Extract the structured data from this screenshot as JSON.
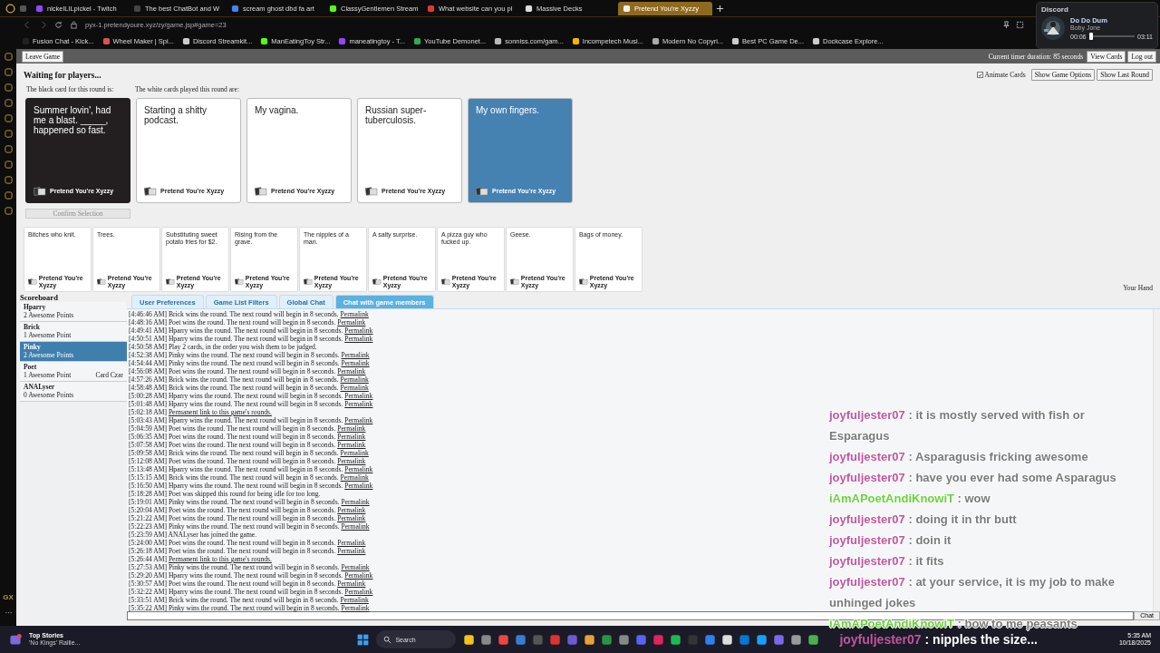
{
  "browser": {
    "tabs": [
      {
        "title": "nickelLILpickel - Twitch",
        "color": "#9146ff",
        "selected": false
      },
      {
        "title": "The best ChatBot and W",
        "color": "#444444",
        "selected": false
      },
      {
        "title": "scream ghost dbd fa art",
        "color": "#4285f4",
        "selected": false
      },
      {
        "title": "ClassyGentlemen Stream",
        "color": "#53fc18",
        "selected": false
      },
      {
        "title": "What website can you pl",
        "color": "#e03a2f",
        "selected": false
      },
      {
        "title": "Massive Decks",
        "color": "#dddddd",
        "selected": false
      },
      {
        "title": "Pretend You're Xyzzy",
        "color": "#eeeeee",
        "selected": true
      }
    ],
    "url": "pyx-1.pretendyoure.xyz/zy/game.jsp#game=23",
    "bookmarks": [
      {
        "title": "Fusion Chat - Kick...",
        "color": "#222222"
      },
      {
        "title": "Wheel Maker | Spi...",
        "color": "#d9534f"
      },
      {
        "title": "Discord Streamkit...",
        "color": "#cccccc"
      },
      {
        "title": "ManEatingToy Str...",
        "color": "#53fc18"
      },
      {
        "title": "maneatingtoy - T...",
        "color": "#9146ff"
      },
      {
        "title": "YouTube Demonet...",
        "color": "#34a853"
      },
      {
        "title": "sonniss.com/gam...",
        "color": "#bbbbbb"
      },
      {
        "title": "Incompetech Musi...",
        "color": "#f4b400"
      },
      {
        "title": "Modern No Copyri...",
        "color": "#aaaaaa"
      },
      {
        "title": "Best PC Game De...",
        "color": "#cccccc"
      },
      {
        "title": "Dockcase Explore...",
        "color": "#cccccc"
      }
    ],
    "sidebar_label": "GX"
  },
  "discord_widget": {
    "title": "Discord",
    "track": "Do Do Dum",
    "artist": "Boby Jone",
    "elapsed": "00:06",
    "duration": "03:11",
    "level": 0.05
  },
  "game": {
    "leave_button": "Leave Game",
    "timer": "Current timer duration: 85 seconds",
    "view_cards_button": "View Cards",
    "logout_button": "Log out",
    "status": "Waiting for players...",
    "animate_cards": {
      "label": "Animate Cards",
      "checked": true
    },
    "option_buttons": [
      "Show Game Options",
      "Show Last Round"
    ],
    "black_card_label": "The black card for this round is:",
    "white_cards_label": "The white cards played this round are:",
    "black_card": {
      "text": "Summer lovin', had me a blast. _____, happened so fast.",
      "brand": "Pretend You're Xyzzy"
    },
    "played_cards": [
      {
        "text": "Starting a shitty podcast.",
        "brand": "Pretend You're Xyzzy",
        "selected": false
      },
      {
        "text": "My vagina.",
        "brand": "Pretend You're Xyzzy",
        "selected": false
      },
      {
        "text": "Russian super-tuberculosis.",
        "brand": "Pretend You're Xyzzy",
        "selected": false
      },
      {
        "text": "My own fingers.",
        "brand": "Pretend You're Xyzzy",
        "selected": true
      }
    ],
    "confirm_button": {
      "label": "Confirm Selection",
      "disabled": true
    },
    "hand": [
      {
        "text": "Bitches who knit.",
        "brand": "Pretend You're Xyzzy"
      },
      {
        "text": "Trees.",
        "brand": "Pretend You're Xyzzy"
      },
      {
        "text": "Substituting sweet potato fries for $2.",
        "brand": "Pretend You're Xyzzy"
      },
      {
        "text": "Rising from the grave.",
        "brand": "Pretend You're Xyzzy"
      },
      {
        "text": "The nipples of a man.",
        "brand": "Pretend You're Xyzzy"
      },
      {
        "text": "A salty surprise.",
        "brand": "Pretend You're Xyzzy"
      },
      {
        "text": "A pizza guy who fucked up.",
        "brand": "Pretend You're Xyzzy"
      },
      {
        "text": "Geese.",
        "brand": "Pretend You're Xyzzy"
      },
      {
        "text": "Bags of money.",
        "brand": "Pretend You're Xyzzy"
      }
    ],
    "hand_label": "Your Hand"
  },
  "scoreboard": {
    "title": "Scoreboard",
    "players": [
      {
        "name": "Hparry",
        "points": "2 Awesome Points",
        "selected": false
      },
      {
        "name": "Brick",
        "points": "1 Awesome Point",
        "selected": false
      },
      {
        "name": "Pinky",
        "points": "2 Awesome Points",
        "selected": true
      },
      {
        "name": "Poet",
        "points": "1 Awesome Point",
        "role": "Card Czar",
        "selected": false
      },
      {
        "name": "ANALyser",
        "points": "0 Awesome Points",
        "selected": false
      }
    ]
  },
  "chat": {
    "tabs": [
      {
        "label": "User Preferences",
        "selected": false
      },
      {
        "label": "Game List Filters",
        "selected": false
      },
      {
        "label": "Global Chat",
        "selected": false
      },
      {
        "label": "Chat with game members",
        "selected": true
      }
    ],
    "lines": [
      {
        "time": "[4:46:46 AM]",
        "text": "Brick wins the round. The next round will begin in 8 seconds.",
        "link": "Permalink"
      },
      {
        "time": "[4:48:16 AM]",
        "text": "Poet wins the round. The next round will begin in 8 seconds.",
        "link": "Permalink"
      },
      {
        "time": "[4:49:41 AM]",
        "text": "Hparry wins the round. The next round will begin in 8 seconds.",
        "link": "Permalink"
      },
      {
        "time": "[4:50:51 AM]",
        "text": "Hparry wins the round. The next round will begin in 8 seconds.",
        "link": "Permalink"
      },
      {
        "time": "[4:50:58 AM]",
        "text": "Play 2 cards, in the order you wish them to be judged."
      },
      {
        "time": "[4:52:38 AM]",
        "text": "Pinky wins the round. The next round will begin in 8 seconds.",
        "link": "Permalink"
      },
      {
        "time": "[4:54:44 AM]",
        "text": "Pinky wins the round. The next round will begin in 8 seconds.",
        "link": "Permalink"
      },
      {
        "time": "[4:56:08 AM]",
        "text": "Poet wins the round. The next round will begin in 8 seconds.",
        "link": "Permalink"
      },
      {
        "time": "[4:57:26 AM]",
        "text": "Brick wins the round. The next round will begin in 8 seconds.",
        "link": "Permalink"
      },
      {
        "time": "[4:58:48 AM]",
        "text": "Brick wins the round. The next round will begin in 8 seconds.",
        "link": "Permalink"
      },
      {
        "time": "[5:00:28 AM]",
        "text": "Hparry wins the round. The next round will begin in 8 seconds.",
        "link": "Permalink"
      },
      {
        "time": "[5:01:48 AM]",
        "text": "Hparry wins the round. The next round will begin in 8 seconds.",
        "link": "Permalink"
      },
      {
        "time": "[5:02:18 AM]",
        "link": "Permanent link to this game's rounds."
      },
      {
        "time": "[5:03:43 AM]",
        "text": "Hparry wins the round. The next round will begin in 8 seconds.",
        "link": "Permalink"
      },
      {
        "time": "[5:04:59 AM]",
        "text": "Poet wins the round. The next round will begin in 8 seconds.",
        "link": "Permalink"
      },
      {
        "time": "[5:06:35 AM]",
        "text": "Poet wins the round. The next round will begin in 8 seconds.",
        "link": "Permalink"
      },
      {
        "time": "[5:07:58 AM]",
        "text": "Poet wins the round. The next round will begin in 8 seconds.",
        "link": "Permalink"
      },
      {
        "time": "[5:09:58 AM]",
        "text": "Brick wins the round. The next round will begin in 8 seconds.",
        "link": "Permalink"
      },
      {
        "time": "[5:12:08 AM]",
        "text": "Poet wins the round. The next round will begin in 8 seconds.",
        "link": "Permalink"
      },
      {
        "time": "[5:13:48 AM]",
        "text": "Hparry wins the round. The next round will begin in 8 seconds.",
        "link": "Permalink"
      },
      {
        "time": "[5:15:15 AM]",
        "text": "Brick wins the round. The next round will begin in 8 seconds.",
        "link": "Permalink"
      },
      {
        "time": "[5:16:50 AM]",
        "text": "Hparry wins the round. The next round will begin in 8 seconds.",
        "link": "Permalink"
      },
      {
        "time": "[5:18:28 AM]",
        "text": "Poet was skipped this round for being idle for too long."
      },
      {
        "time": "[5:19:01 AM]",
        "text": "Pinky wins the round. The next round will begin in 8 seconds.",
        "link": "Permalink"
      },
      {
        "time": "[5:20:04 AM]",
        "text": "Poet wins the round. The next round will begin in 8 seconds.",
        "link": "Permalink"
      },
      {
        "time": "[5:21:22 AM]",
        "text": "Poet wins the round. The next round will begin in 8 seconds.",
        "link": "Permalink"
      },
      {
        "time": "[5:22:23 AM]",
        "text": "Pinky wins the round. The next round will begin in 8 seconds.",
        "link": "Permalink"
      },
      {
        "time": "[5:23:59 AM]",
        "text": "ANALyser has joined the game."
      },
      {
        "time": "[5:24:00 AM]",
        "text": "Poet wins the round. The next round will begin in 8 seconds.",
        "link": "Permalink"
      },
      {
        "time": "[5:26:18 AM]",
        "text": "Poet wins the round. The next round will begin in 8 seconds.",
        "link": "Permalink"
      },
      {
        "time": "[5:26:44 AM]",
        "link": "Permanent link to this game's rounds."
      },
      {
        "time": "[5:27:53 AM]",
        "text": "Pinky wins the round. The next round will begin in 8 seconds.",
        "link": "Permalink"
      },
      {
        "time": "[5:29:20 AM]",
        "text": "Hparry wins the round. The next round will begin in 8 seconds.",
        "link": "Permalink"
      },
      {
        "time": "[5:30:57 AM]",
        "text": "Poet wins the round. The next round will begin in 8 seconds.",
        "link": "Permalink"
      },
      {
        "time": "[5:32:22 AM]",
        "text": "Hparry wins the round. The next round will begin in 8 seconds.",
        "link": "Permalink"
      },
      {
        "time": "[5:33:51 AM]",
        "text": "Brick wins the round. The next round will begin in 8 seconds.",
        "link": "Permalink"
      },
      {
        "time": "[5:35:22 AM]",
        "text": "Pinky wins the round. The next round will begin in 8 seconds.",
        "link": "Permalink"
      }
    ],
    "send_button": "Chat"
  },
  "stream_chat": [
    {
      "user": "joyfuljester07",
      "color": "#c2559f",
      "text": ": it is mostly served with fish or Esparagus"
    },
    {
      "user": "joyfuljester07",
      "color": "#c2559f",
      "text": ": Asparagusis fricking awesome"
    },
    {
      "user": "joyfuljester07",
      "color": "#c2559f",
      "text": ": have you ever had some Asparagus"
    },
    {
      "user": "iAmAPoetAndiKnowiT",
      "color": "#6ad13c",
      "text": ": wow"
    },
    {
      "user": "joyfuljester07",
      "color": "#c2559f",
      "text": ": doing it in thr butt"
    },
    {
      "user": "joyfuljester07",
      "color": "#c2559f",
      "text": ": doin it"
    },
    {
      "user": "joyfuljester07",
      "color": "#c2559f",
      "text": ": it fits"
    },
    {
      "user": "joyfuljester07",
      "color": "#c2559f",
      "text": ": at your service, it is my job to make unhinged jokes"
    },
    {
      "user": "iAmAPoetAndiKnowiT",
      "color": "#6ad13c",
      "text": ": bow to me peasants"
    }
  ],
  "taskbar": {
    "news_title": "Top Stories",
    "news_headline": "'No Kings' Rallie...",
    "search": "Search",
    "overlay": {
      "user": "joyfuljester07",
      "color": "#c2559f",
      "text": ": nipples the size..."
    },
    "time": "5:35 AM",
    "date": "10/18/2025"
  }
}
